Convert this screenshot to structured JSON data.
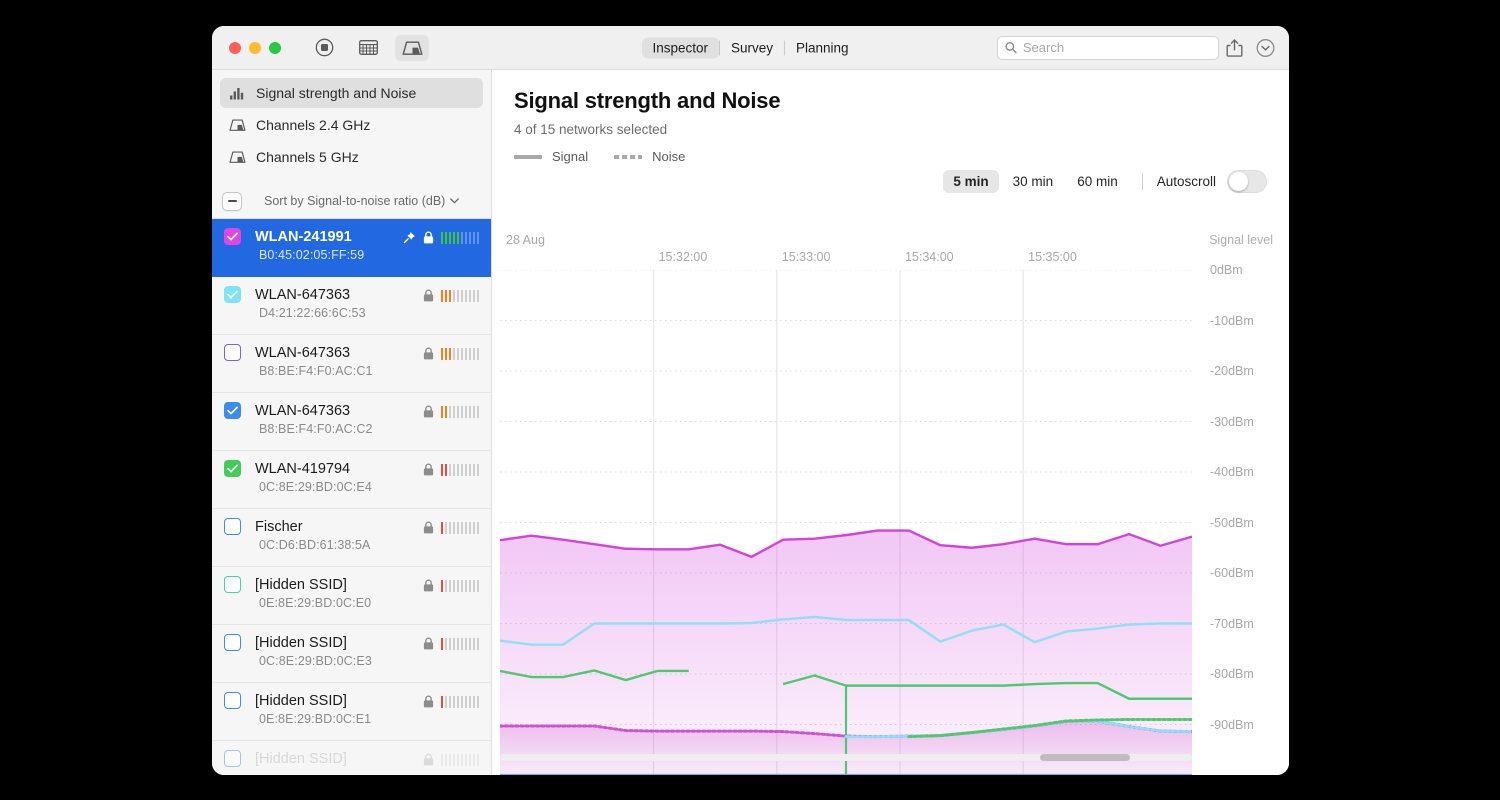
{
  "window": {
    "traffic_lights": [
      "close",
      "minimize",
      "zoom"
    ],
    "toolbar_icons": [
      "record-icon",
      "table-icon",
      "chart-icon"
    ],
    "tabs": [
      {
        "label": "Inspector",
        "active": true
      },
      {
        "label": "Survey",
        "active": false
      },
      {
        "label": "Planning",
        "active": false
      }
    ],
    "search": {
      "placeholder": "Search",
      "value": ""
    },
    "right_icons": [
      "share-icon",
      "chevron-down-circle-icon"
    ]
  },
  "sidebar": {
    "nav": [
      {
        "label": "Signal strength and Noise",
        "icon": "bar-chart-icon",
        "active": true
      },
      {
        "label": "Channels 2.4 GHz",
        "icon": "channel-chart-icon",
        "active": false
      },
      {
        "label": "Channels 5 GHz",
        "icon": "channel-chart-icon",
        "active": false
      }
    ],
    "sort": {
      "label": "Sort by Signal-to-noise ratio (dB)",
      "collapse_label": "collapse"
    },
    "networks": [
      {
        "ssid": "WLAN-241991",
        "bssid": "B0:45:02:05:FF:59",
        "checked": true,
        "color": "#e046e0",
        "selected": true,
        "pinned": true,
        "locked": true,
        "bars": 5,
        "bar_color": "#3ec43e",
        "dim": false
      },
      {
        "ssid": "WLAN-647363",
        "bssid": "D4:21:22:66:6C:53",
        "checked": true,
        "color": "#7fe4f2",
        "selected": false,
        "pinned": false,
        "locked": true,
        "bars": 3,
        "bar_color": "#f58020",
        "dim": false
      },
      {
        "ssid": "WLAN-647363",
        "bssid": "B8:BE:F4:F0:AC:C1",
        "checked": false,
        "color": "#7d5cf0",
        "selected": false,
        "pinned": false,
        "locked": true,
        "bars": 3,
        "bar_color": "#f58020",
        "dim": false
      },
      {
        "ssid": "WLAN-647363",
        "bssid": "B8:BE:F4:F0:AC:C2",
        "checked": true,
        "color": "#3b8bf0",
        "selected": false,
        "pinned": false,
        "locked": true,
        "bars": 2,
        "bar_color": "#f58020",
        "dim": false
      },
      {
        "ssid": "WLAN-419794",
        "bssid": "0C:8E:29:BD:0C:E4",
        "checked": true,
        "color": "#44cc5a",
        "selected": false,
        "pinned": false,
        "locked": true,
        "bars": 2,
        "bar_color": "#f04a3a",
        "dim": false
      },
      {
        "ssid": "Fischer",
        "bssid": "0C:D6:BD:61:38:5A",
        "checked": false,
        "color": "#3b8bf0",
        "selected": false,
        "pinned": false,
        "locked": true,
        "bars": 1,
        "bar_color": "#f04a3a",
        "dim": false
      },
      {
        "ssid": "[Hidden SSID]",
        "bssid": "0E:8E:29:BD:0C:E0",
        "checked": false,
        "color": "#3fd6a8",
        "selected": false,
        "pinned": false,
        "locked": true,
        "bars": 1,
        "bar_color": "#f04a3a",
        "dim": false
      },
      {
        "ssid": "[Hidden SSID]",
        "bssid": "0C:8E:29:BD:0C:E3",
        "checked": false,
        "color": "#3b8bf0",
        "selected": false,
        "pinned": false,
        "locked": true,
        "bars": 1,
        "bar_color": "#f04a3a",
        "dim": false
      },
      {
        "ssid": "[Hidden SSID]",
        "bssid": "0E:8E:29:BD:0C:E1",
        "checked": false,
        "color": "#3b8bf0",
        "selected": false,
        "pinned": false,
        "locked": true,
        "bars": 1,
        "bar_color": "#f04a3a",
        "dim": false
      },
      {
        "ssid": "[Hidden SSID]",
        "bssid": "",
        "checked": false,
        "color": "#3b8bf0",
        "selected": false,
        "pinned": false,
        "locked": true,
        "bars": 0,
        "bar_color": "#cfcfcf",
        "dim": true
      }
    ]
  },
  "main": {
    "title": "Signal strength and Noise",
    "subtitle": "4 of 15 networks selected",
    "legend": [
      {
        "label": "Signal",
        "style": "solid"
      },
      {
        "label": "Noise",
        "style": "dashed"
      }
    ],
    "ranges": [
      {
        "label": "5 min",
        "active": true
      },
      {
        "label": "30 min",
        "active": false
      },
      {
        "label": "60 min",
        "active": false
      }
    ],
    "autoscroll": {
      "label": "Autoscroll",
      "on": false
    },
    "scrollbar": {
      "thumb_left_pct": 78,
      "thumb_width_pct": 13
    }
  },
  "chart_data": {
    "type": "line",
    "title": "Signal strength and Noise",
    "xlabel": "",
    "ylabel": "Signal level",
    "date_label": "28 Aug",
    "grid": true,
    "ylim": [
      -100,
      0
    ],
    "yticks": [
      0,
      -10,
      -20,
      -30,
      -40,
      -50,
      -60,
      -70,
      -80,
      -90
    ],
    "ytick_labels": [
      "0dBm",
      "-10dBm",
      "-20dBm",
      "-30dBm",
      "-40dBm",
      "-50dBm",
      "-60dBm",
      "-70dBm",
      "-80dBm",
      "-90dBm"
    ],
    "xticks": [
      "15:32:00",
      "15:33:00",
      "15:34:00",
      "15:35:00"
    ],
    "xtick_positions": [
      0.222,
      0.4,
      0.578,
      0.756
    ],
    "legend_position": "top-left",
    "series": [
      {
        "name": "WLAN-241991 signal",
        "color": "#d243dd",
        "style": "solid",
        "filled": true,
        "values": [
          -53.5,
          -52.6,
          -53.4,
          -54.3,
          -55.2,
          -55.3,
          -55.3,
          -54.4,
          -56.8,
          -53.4,
          -53.2,
          -52.5,
          -51.6,
          -51.6,
          -54.5,
          -55.0,
          -54.3,
          -53.2,
          -54.3,
          -54.3,
          -52.3,
          -54.6,
          -52.8
        ]
      },
      {
        "name": "WLAN-647363 signal",
        "color": "#8fdff5",
        "style": "solid",
        "filled": false,
        "values": [
          -73.4,
          -74.2,
          -74.2,
          -70.0,
          -70.0,
          -70.0,
          -70.0,
          -70.0,
          -69.9,
          -69.2,
          -68.7,
          -69.3,
          -69.3,
          -69.3,
          -73.6,
          -71.4,
          -70.2,
          -73.7,
          -71.6,
          -71.0,
          -70.2,
          -70.0,
          -70.0
        ]
      },
      {
        "name": "WLAN-419794 signal",
        "color": "#4fc96e",
        "style": "solid",
        "filled": false,
        "gap": [
          8,
          11
        ],
        "values": [
          -79.4,
          -80.6,
          -80.6,
          -79.3,
          -81.2,
          -79.4,
          -79.4,
          null,
          null,
          -82.0,
          -80.3,
          -82.3,
          -82.3,
          -82.3,
          -82.3,
          -82.3,
          -82.3,
          -82.0,
          -81.8,
          -81.8,
          -84.9,
          -84.9,
          -84.9
        ]
      },
      {
        "name": "WLAN-241991 noise",
        "color": "#cc55cc",
        "style": "dotted",
        "filled": true,
        "values": [
          -90.3,
          -90.3,
          -90.3,
          -90.3,
          -91.2,
          -91.3,
          -91.3,
          -91.3,
          -91.3,
          -91.4,
          -91.8,
          -92.3,
          -92.4,
          -92.3,
          -92.2,
          -91.6,
          -91.0,
          -90.3,
          -89.4,
          -89.3,
          -90.4,
          -91.3,
          -91.4
        ]
      },
      {
        "name": "WLAN-647363 noise",
        "color": "#8fdff5",
        "style": "dotted",
        "filled": false,
        "values": [
          null,
          null,
          null,
          null,
          null,
          null,
          null,
          null,
          null,
          null,
          null,
          -92.4,
          -92.4,
          -92.3,
          -92.2,
          -91.6,
          -91.0,
          -90.3,
          -89.4,
          -89.3,
          -90.4,
          -91.3,
          -91.4
        ]
      },
      {
        "name": "WLAN-419794 noise",
        "color": "#4fc96e",
        "style": "dotted",
        "filled": false,
        "values": [
          null,
          null,
          null,
          null,
          null,
          null,
          null,
          null,
          null,
          null,
          null,
          null,
          null,
          -92.4,
          -92.2,
          -91.6,
          -90.9,
          -90.2,
          -89.3,
          -89.1,
          -89.0,
          -89.0,
          -89.0
        ]
      }
    ]
  }
}
